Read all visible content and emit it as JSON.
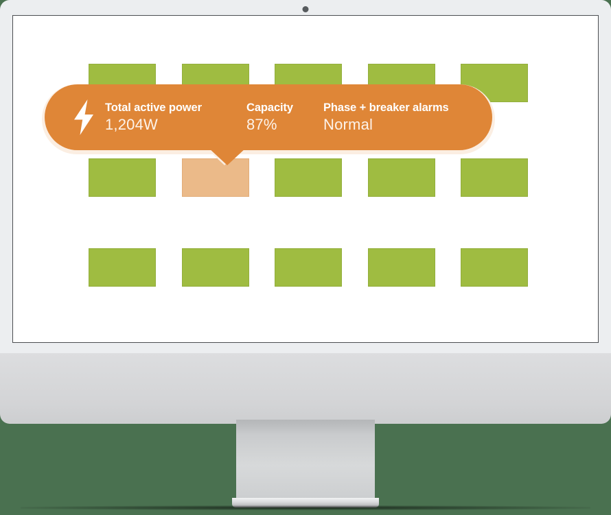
{
  "device": {
    "type": "desktop-monitor",
    "camera_dot": true
  },
  "colors": {
    "background_green": "#4a7150",
    "monitor_frame": "#eceef0",
    "monitor_chin": "#d3d4d6",
    "screen": "#ffffff",
    "rack_cell_green": "#9fbc41",
    "rack_cell_green_border": "#93ae3c",
    "rack_cell_highlight": "#ebba89",
    "tooltip_orange": "#df8637",
    "tooltip_outline_cream": "#fbeee2",
    "text_white": "#ffffff"
  },
  "screen_content": {
    "rack_rows": [
      {
        "row_id": "row-1",
        "cells": [
          {
            "state": "normal"
          },
          {
            "state": "normal"
          },
          {
            "state": "normal"
          },
          {
            "state": "normal"
          },
          {
            "state": "normal"
          }
        ]
      },
      {
        "row_id": "row-2",
        "cells": [
          {
            "state": "normal"
          },
          {
            "state": "selected"
          },
          {
            "state": "normal"
          },
          {
            "state": "normal"
          },
          {
            "state": "normal"
          }
        ]
      },
      {
        "row_id": "row-3",
        "cells": [
          {
            "state": "normal"
          },
          {
            "state": "normal"
          },
          {
            "state": "normal"
          },
          {
            "state": "normal"
          },
          {
            "state": "normal"
          }
        ]
      }
    ],
    "tooltip": {
      "icon": "lightning-bolt-icon",
      "stats": [
        {
          "label": "Total active power",
          "value": "1,204W"
        },
        {
          "label": "Capacity",
          "value": "87%"
        },
        {
          "label": "Phase + breaker alarms",
          "value": "Normal"
        }
      ]
    }
  }
}
